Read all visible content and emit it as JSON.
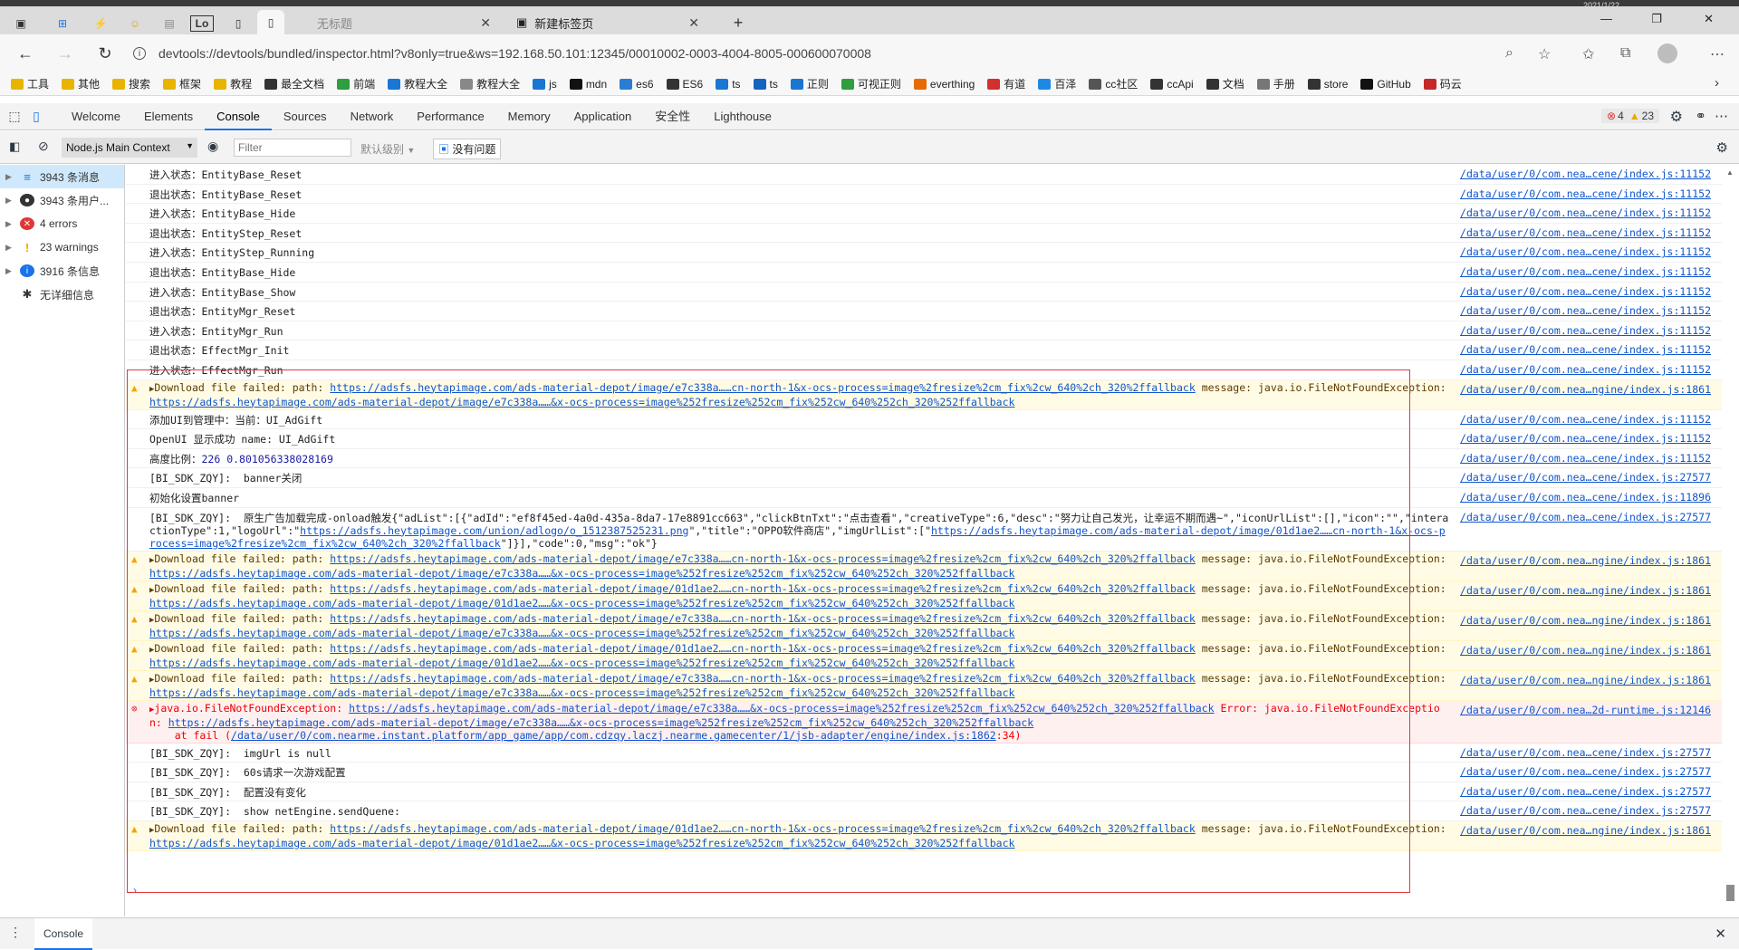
{
  "browser": {
    "tabs": [
      {
        "label": "无标题"
      },
      {
        "label": "新建标签页"
      }
    ],
    "pinned_label": "Lo",
    "clock": "2021/1/22",
    "url": "devtools://devtools/bundled/inspector.html?v8only=true&ws=192.168.50.101:12345/00010002-0003-4004-8005-000600070008",
    "bookmarks": [
      {
        "label": "工具",
        "color": "#e8b400"
      },
      {
        "label": "其他",
        "color": "#e8b400"
      },
      {
        "label": "搜索",
        "color": "#e8b400"
      },
      {
        "label": "框架",
        "color": "#e8b400"
      },
      {
        "label": "教程",
        "color": "#e8b400"
      },
      {
        "label": "最全文档",
        "color": "#333333"
      },
      {
        "label": "前端",
        "color": "#2e9e3f"
      },
      {
        "label": "教程大全",
        "color": "#1976d2"
      },
      {
        "label": "教程大全",
        "color": "#888888"
      },
      {
        "label": "js",
        "color": "#1976d2"
      },
      {
        "label": "mdn",
        "color": "#111111"
      },
      {
        "label": "es6",
        "color": "#2b7cd3"
      },
      {
        "label": "ES6",
        "color": "#333333"
      },
      {
        "label": "ts",
        "color": "#1976d2"
      },
      {
        "label": "ts",
        "color": "#1565c0"
      },
      {
        "label": "正则",
        "color": "#1976d2"
      },
      {
        "label": "可视正则",
        "color": "#2e9e3f"
      },
      {
        "label": "everthing",
        "color": "#e66a00"
      },
      {
        "label": "有道",
        "color": "#d32f2f"
      },
      {
        "label": "百泽",
        "color": "#1e88e5"
      },
      {
        "label": "cc社区",
        "color": "#555555"
      },
      {
        "label": "ccApi",
        "color": "#333333"
      },
      {
        "label": "文档",
        "color": "#333333"
      },
      {
        "label": "手册",
        "color": "#777777"
      },
      {
        "label": "store",
        "color": "#333333"
      },
      {
        "label": "GitHub",
        "color": "#111111"
      },
      {
        "label": "码云",
        "color": "#c62828"
      }
    ]
  },
  "devtools": {
    "tabs": [
      "Welcome",
      "Elements",
      "Console",
      "Sources",
      "Network",
      "Performance",
      "Memory",
      "Application",
      "安全性",
      "Lighthouse"
    ],
    "errors": "4",
    "warnings": "23",
    "toolbar": {
      "context": "Node.js Main Context",
      "filter_placeholder": "Filter",
      "levels": "默认级别",
      "issues": "没有问题"
    },
    "sidebar": [
      {
        "label": "3943 条消息",
        "icon": "list",
        "color": "#1a73e8"
      },
      {
        "label": "3943 条用户...",
        "icon": "user",
        "color": "#333333"
      },
      {
        "label": "4 errors",
        "icon": "error",
        "color": "#e23636"
      },
      {
        "label": "23 warnings",
        "icon": "warning",
        "color": "#f2a600"
      },
      {
        "label": "3916 条信息",
        "icon": "info",
        "color": "#1a73e8"
      },
      {
        "label": "无详细信息",
        "icon": "bug",
        "color": "#333333"
      }
    ],
    "drawer_tab": "Console"
  },
  "console_rows": [
    {
      "type": "log",
      "text": "进入状态：EntityBase_Reset",
      "src": "/data/user/0/com.nea…cene/index.js:11152"
    },
    {
      "type": "log",
      "text": "退出状态：EntityBase_Reset",
      "src": "/data/user/0/com.nea…cene/index.js:11152"
    },
    {
      "type": "log",
      "text": "进入状态：EntityBase_Hide",
      "src": "/data/user/0/com.nea…cene/index.js:11152"
    },
    {
      "type": "log",
      "text": "退出状态：EntityStep_Reset",
      "src": "/data/user/0/com.nea…cene/index.js:11152"
    },
    {
      "type": "log",
      "text": "进入状态：EntityStep_Running",
      "src": "/data/user/0/com.nea…cene/index.js:11152"
    },
    {
      "type": "log",
      "text": "退出状态：EntityBase_Hide",
      "src": "/data/user/0/com.nea…cene/index.js:11152"
    },
    {
      "type": "log",
      "text": "进入状态：EntityBase_Show",
      "src": "/data/user/0/com.nea…cene/index.js:11152"
    },
    {
      "type": "log",
      "text": "退出状态：EntityMgr_Reset",
      "src": "/data/user/0/com.nea…cene/index.js:11152"
    },
    {
      "type": "log",
      "text": "进入状态：EntityMgr_Run",
      "src": "/data/user/0/com.nea…cene/index.js:11152"
    },
    {
      "type": "log",
      "text": "退出状态：EffectMgr_Init",
      "src": "/data/user/0/com.nea…cene/index.js:11152"
    },
    {
      "type": "log",
      "text": "进入状态：EffectMgr_Run",
      "src": "/data/user/0/com.nea…cene/index.js:11152"
    },
    {
      "type": "warn",
      "pre": "Download file failed: path: ",
      "link1": "https://adsfs.heytapimage.com/ads-material-depot/image/e7c338a……cn-north-1&x-ocs-process=image%2fresize%2cm_fix%2cw_640%2ch_320%2ffallback",
      "mid": " message: java.io.FileNotFoundException: ",
      "link2": "https://adsfs.heytapimage.com/ads-material-depot/image/e7c338a……&x-ocs-process=image%252fresize%252cm_fix%252cw_640%252ch_320%252ffallback",
      "src": "/data/user/0/com.nea…ngine/index.js:1861"
    },
    {
      "type": "log",
      "text": "添加UI到管理中：当前：UI_AdGift",
      "src": "/data/user/0/com.nea…cene/index.js:11152"
    },
    {
      "type": "log",
      "text": "OpenUI 显示成功 name: UI_AdGift",
      "src": "/data/user/0/com.nea…cene/index.js:11152"
    },
    {
      "type": "lognum",
      "pre": "高度比例：",
      "nums": "226 0.801056338028169",
      "src": "/data/user/0/com.nea…cene/index.js:11152"
    },
    {
      "type": "log",
      "text": "[BI_SDK_ZQY]:  banner关闭",
      "src": "/data/user/0/com.nea…cene/index.js:27577"
    },
    {
      "type": "log",
      "text": "初始化设置banner",
      "src": "/data/user/0/com.nea…cene/index.js:11896"
    },
    {
      "type": "json",
      "pre": "[BI_SDK_ZQY]:  原生广告加载完成-onload触发{\"adList\":[{\"adId\":\"ef8f45ed-4a0d-435a-8da7-17e8891cc663\",\"clickBtnTxt\":\"点击查看\",\"creativeType\":6,\"desc\":\"努力让自己发光，让幸运不期而遇~\",\"iconUrlList\":[],\"icon\":\"\",\"interactionType\":1,\"logoUrl\":\"",
      "link1": "https://adsfs.heytapimage.com/union/adlogo/o_1512387525231.png",
      "mid": "\",\"title\":\"OPPO软件商店\",\"imgUrlList\":[\"",
      "link2": "https://adsfs.heytapimage.com/ads-material-depot/image/01d1ae2……cn-north-1&x-ocs-process=image%2fresize%2cm_fix%2cw_640%2ch_320%2ffallback",
      "post": "\"]}],\"code\":0,\"msg\":\"ok\"}",
      "src": "/data/user/0/com.nea…cene/index.js:27577"
    },
    {
      "type": "warn",
      "pre": "Download file failed: path: ",
      "link1": "https://adsfs.heytapimage.com/ads-material-depot/image/e7c338a……cn-north-1&x-ocs-process=image%2fresize%2cm_fix%2cw_640%2ch_320%2ffallback",
      "mid": " message: java.io.FileNotFoundException: ",
      "link2": "https://adsfs.heytapimage.com/ads-material-depot/image/e7c338a……&x-ocs-process=image%252fresize%252cm_fix%252cw_640%252ch_320%252ffallback",
      "src": "/data/user/0/com.nea…ngine/index.js:1861"
    },
    {
      "type": "warn",
      "pre": "Download file failed: path: ",
      "link1": "https://adsfs.heytapimage.com/ads-material-depot/image/01d1ae2……cn-north-1&x-ocs-process=image%2fresize%2cm_fix%2cw_640%2ch_320%2ffallback",
      "mid": " message: java.io.FileNotFoundException: ",
      "link2": "https://adsfs.heytapimage.com/ads-material-depot/image/01d1ae2……&x-ocs-process=image%252fresize%252cm_fix%252cw_640%252ch_320%252ffallback",
      "src": "/data/user/0/com.nea…ngine/index.js:1861"
    },
    {
      "type": "warn",
      "pre": "Download file failed: path: ",
      "link1": "https://adsfs.heytapimage.com/ads-material-depot/image/e7c338a……cn-north-1&x-ocs-process=image%2fresize%2cm_fix%2cw_640%2ch_320%2ffallback",
      "mid": " message: java.io.FileNotFoundException: ",
      "link2": "https://adsfs.heytapimage.com/ads-material-depot/image/e7c338a……&x-ocs-process=image%252fresize%252cm_fix%252cw_640%252ch_320%252ffallback",
      "src": "/data/user/0/com.nea…ngine/index.js:1861"
    },
    {
      "type": "warn",
      "pre": "Download file failed: path: ",
      "link1": "https://adsfs.heytapimage.com/ads-material-depot/image/01d1ae2……cn-north-1&x-ocs-process=image%2fresize%2cm_fix%2cw_640%2ch_320%2ffallback",
      "mid": " message: java.io.FileNotFoundException: ",
      "link2": "https://adsfs.heytapimage.com/ads-material-depot/image/01d1ae2……&x-ocs-process=image%252fresize%252cm_fix%252cw_640%252ch_320%252ffallback",
      "src": "/data/user/0/com.nea…ngine/index.js:1861"
    },
    {
      "type": "warn",
      "pre": "Download file failed: path: ",
      "link1": "https://adsfs.heytapimage.com/ads-material-depot/image/e7c338a……cn-north-1&x-ocs-process=image%2fresize%2cm_fix%2cw_640%2ch_320%2ffallback",
      "mid": " message: java.io.FileNotFoundException: ",
      "link2": "https://adsfs.heytapimage.com/ads-material-depot/image/e7c338a……&x-ocs-process=image%252fresize%252cm_fix%252cw_640%252ch_320%252ffallback",
      "src": "/data/user/0/com.nea…ngine/index.js:1861"
    },
    {
      "type": "error",
      "pre": "java.io.FileNotFoundException: ",
      "link1": "https://adsfs.heytapimage.com/ads-material-depot/image/e7c338a……&x-ocs-process=image%252fresize%252cm_fix%252cw_640%252ch_320%252ffallback",
      "mid": " Error: java.io.FileNotFoundException: ",
      "link2": "https://adsfs.heytapimage.com/ads-material-depot/image/e7c338a……&x-ocs-process=image%252fresize%252cm_fix%252cw_640%252ch_320%252ffallback",
      "stack_pre": "    at fail (",
      "stack_link": "/data/user/0/com.nearme.instant.platform/app_game/app/com.cdzqy.laczj.nearme.gamecenter/1/jsb-adapter/engine/index.js:1862",
      "stack_post": ":34)",
      "src": "/data/user/0/com.nea…2d-runtime.js:12146"
    },
    {
      "type": "log",
      "text": "[BI_SDK_ZQY]:  imgUrl is null",
      "src": "/data/user/0/com.nea…cene/index.js:27577"
    },
    {
      "type": "log",
      "text": "[BI_SDK_ZQY]:  60s请求一次游戏配置",
      "src": "/data/user/0/com.nea…cene/index.js:27577"
    },
    {
      "type": "log",
      "text": "[BI_SDK_ZQY]:  配置没有变化",
      "src": "/data/user/0/com.nea…cene/index.js:27577"
    },
    {
      "type": "log",
      "text": "[BI_SDK_ZQY]:  show netEngine.sendQuene:",
      "src": "/data/user/0/com.nea…cene/index.js:27577"
    },
    {
      "type": "warn",
      "pre": "Download file failed: path: ",
      "link1": "https://adsfs.heytapimage.com/ads-material-depot/image/01d1ae2……cn-north-1&x-ocs-process=image%2fresize%2cm_fix%2cw_640%2ch_320%2ffallback",
      "mid": " message: java.io.FileNotFoundException: ",
      "link2": "https://adsfs.heytapimage.com/ads-material-depot/image/01d1ae2……&x-ocs-process=image%252fresize%252cm_fix%252cw_640%252ch_320%252ffallback",
      "src": "/data/user/0/com.nea…ngine/index.js:1861"
    }
  ]
}
